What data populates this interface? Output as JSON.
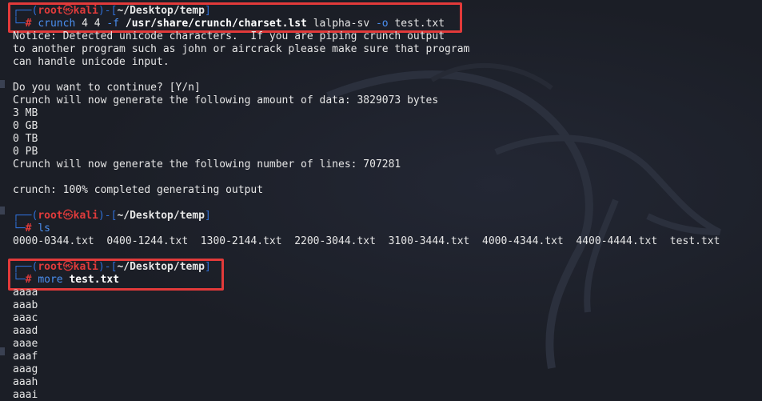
{
  "prompt1": {
    "user": "root",
    "host": "kali",
    "path": "~/Desktop/temp",
    "command": "crunch",
    "args_plain1": " 4 4 ",
    "opt_f": "-f",
    "charset_path": "/usr/share/crunch/charset.lst",
    "charset_name": " lalpha-sv ",
    "opt_o": "-o",
    "outfile": " test.txt"
  },
  "output1": [
    "Notice: Detected unicode characters.  If you are piping crunch output",
    "to another program such as john or aircrack please make sure that program",
    "can handle unicode input.",
    "",
    "Do you want to continue? [Y/n]",
    "Crunch will now generate the following amount of data: 3829073 bytes",
    "3 MB",
    "0 GB",
    "0 TB",
    "0 PB",
    "Crunch will now generate the following number of lines: 707281",
    "",
    "crunch: 100% completed generating output"
  ],
  "prompt2": {
    "user": "root",
    "host": "kali",
    "path": "~/Desktop/temp",
    "command": "ls"
  },
  "ls_output": "0000-0344.txt  0400-1244.txt  1300-2144.txt  2200-3044.txt  3100-3444.txt  4000-4344.txt  4400-4444.txt  test.txt",
  "prompt3": {
    "user": "root",
    "host": "kali",
    "path": "~/Desktop/temp",
    "command": "more",
    "arg": " test.txt"
  },
  "more_output": [
    "aaaa",
    "aaab",
    "aaac",
    "aaad",
    "aaae",
    "aaaf",
    "aaag",
    "aaah",
    "aaai"
  ],
  "colors": {
    "background": "#1b1e26",
    "frame": "#2f6fd6",
    "prompt_user": "#e03b3b",
    "command": "#4a8ff0",
    "highlight_box": "#e23a3a"
  },
  "icons": {
    "skull": "skull-icon",
    "background": "kali-dragon-logo"
  }
}
